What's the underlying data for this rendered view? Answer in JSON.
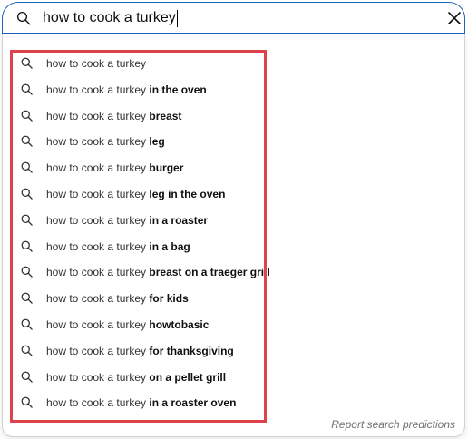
{
  "search": {
    "query": "how to cook a turkey"
  },
  "suggestions": [
    {
      "prefix": "how to cook a turkey",
      "completion": ""
    },
    {
      "prefix": "how to cook a turkey",
      "completion": " in the oven"
    },
    {
      "prefix": "how to cook a turkey",
      "completion": " breast"
    },
    {
      "prefix": "how to cook a turkey",
      "completion": " leg"
    },
    {
      "prefix": "how to cook a turkey",
      "completion": " burger"
    },
    {
      "prefix": "how to cook a turkey",
      "completion": " leg in the oven"
    },
    {
      "prefix": "how to cook a turkey",
      "completion": " in a roaster"
    },
    {
      "prefix": "how to cook a turkey",
      "completion": " in a bag"
    },
    {
      "prefix": "how to cook a turkey",
      "completion": " breast on a traeger grill"
    },
    {
      "prefix": "how to cook a turkey",
      "completion": " for kids"
    },
    {
      "prefix": "how to cook a turkey",
      "completion": " howtobasic"
    },
    {
      "prefix": "how to cook a turkey",
      "completion": " for thanksgiving"
    },
    {
      "prefix": "how to cook a turkey",
      "completion": " on a pellet grill"
    },
    {
      "prefix": "how to cook a turkey",
      "completion": " in a roaster oven"
    }
  ],
  "footer": {
    "report_label": "Report search predictions"
  },
  "icons": {
    "search": "search-icon",
    "clear": "close-icon"
  },
  "colors": {
    "focus_border": "#1c62b9",
    "highlight": "#e0424b"
  }
}
